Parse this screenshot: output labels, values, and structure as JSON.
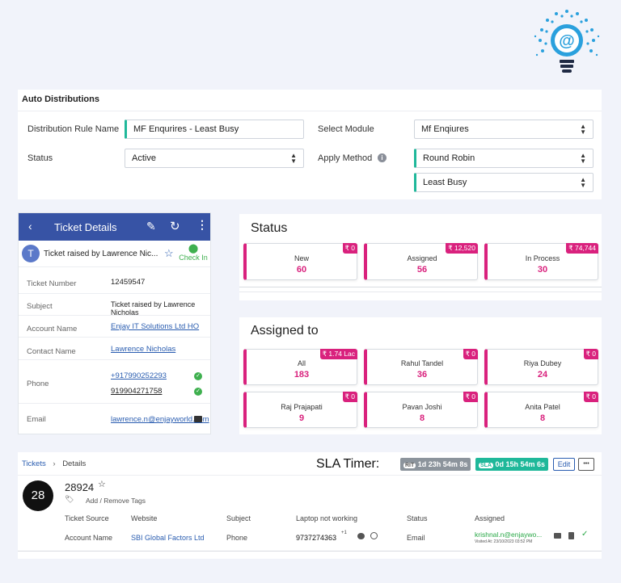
{
  "auto": {
    "title": "Auto Distributions",
    "rule_label": "Distribution Rule Name",
    "rule_value": "MF Enqurires - Least Busy",
    "module_label": "Select Module",
    "module_value": "Mf Enqiures",
    "status_label": "Status",
    "status_value": "Active",
    "apply_label": "Apply Method",
    "apply_value": "Round Robin",
    "apply_sub_value": "Least Busy"
  },
  "ticket": {
    "header": "Ticket Details",
    "avatar": "T",
    "subject_line": "Ticket raised by Lawrence Nic...",
    "checkin": "Check In",
    "rows": {
      "number_label": "Ticket Number",
      "number": "12459547",
      "subject_label": "Subject",
      "subject": "Ticket raised by Lawrence Nicholas",
      "account_label": "Account Name",
      "account": "Enjay IT Solutions Ltd HO",
      "contact_label": "Contact Name",
      "contact": "Lawrence Nicholas",
      "phone_label": "Phone",
      "phone1": "+917990252293",
      "phone2": "919904271758",
      "email_label": "Email",
      "email": "lawrence.n@enjayworld.com"
    }
  },
  "status": {
    "title": "Status",
    "items": [
      {
        "label": "New",
        "value": "60",
        "badge": "₹ 0"
      },
      {
        "label": "Assigned",
        "value": "56",
        "badge": "₹ 12,520"
      },
      {
        "label": "In Process",
        "value": "30",
        "badge": "₹ 74,744"
      }
    ]
  },
  "assigned": {
    "title": "Assigned to",
    "items": [
      {
        "label": "All",
        "value": "183",
        "badge": "₹ 1.74 Lac"
      },
      {
        "label": "Rahul Tandel",
        "value": "36",
        "badge": "₹ 0"
      },
      {
        "label": "Riya Dubey",
        "value": "24",
        "badge": "₹ 0"
      },
      {
        "label": "Raj Prajapati",
        "value": "9",
        "badge": "₹ 0"
      },
      {
        "label": "Pavan Joshi",
        "value": "8",
        "badge": "₹ 0"
      },
      {
        "label": "Anita Patel",
        "value": "8",
        "badge": "₹ 0"
      }
    ]
  },
  "sla": {
    "crumb_link": "Tickets",
    "crumb_sep": "›",
    "crumb_current": "Details",
    "title": "SLA Timer:",
    "rit_tag": "RIT",
    "rit_time": "1d 23h 54m 8s",
    "sla_tag": "SLA",
    "sla_time": "0d 15h 54m 6s",
    "edit": "Edit",
    "more": "•••",
    "avatar": "28",
    "ticket_id": "28924",
    "tags": "Add / Remove Tags",
    "headers": [
      "Ticket Source",
      "Website",
      "Subject",
      "Laptop not working",
      "Status",
      "Assigned"
    ],
    "values": [
      "Account Name",
      "SBI Global Factors Ltd",
      "Phone",
      "9737274363",
      "Email",
      "krishnal.n@enjaywo..."
    ],
    "phone_sup": "+1",
    "visited": "Visited At: 23/10/2023 03:52 PM"
  },
  "colors": {
    "accent": "#d9217d",
    "header_blue": "#3753a5",
    "green": "#1fb89a",
    "link": "#2a5db0"
  }
}
